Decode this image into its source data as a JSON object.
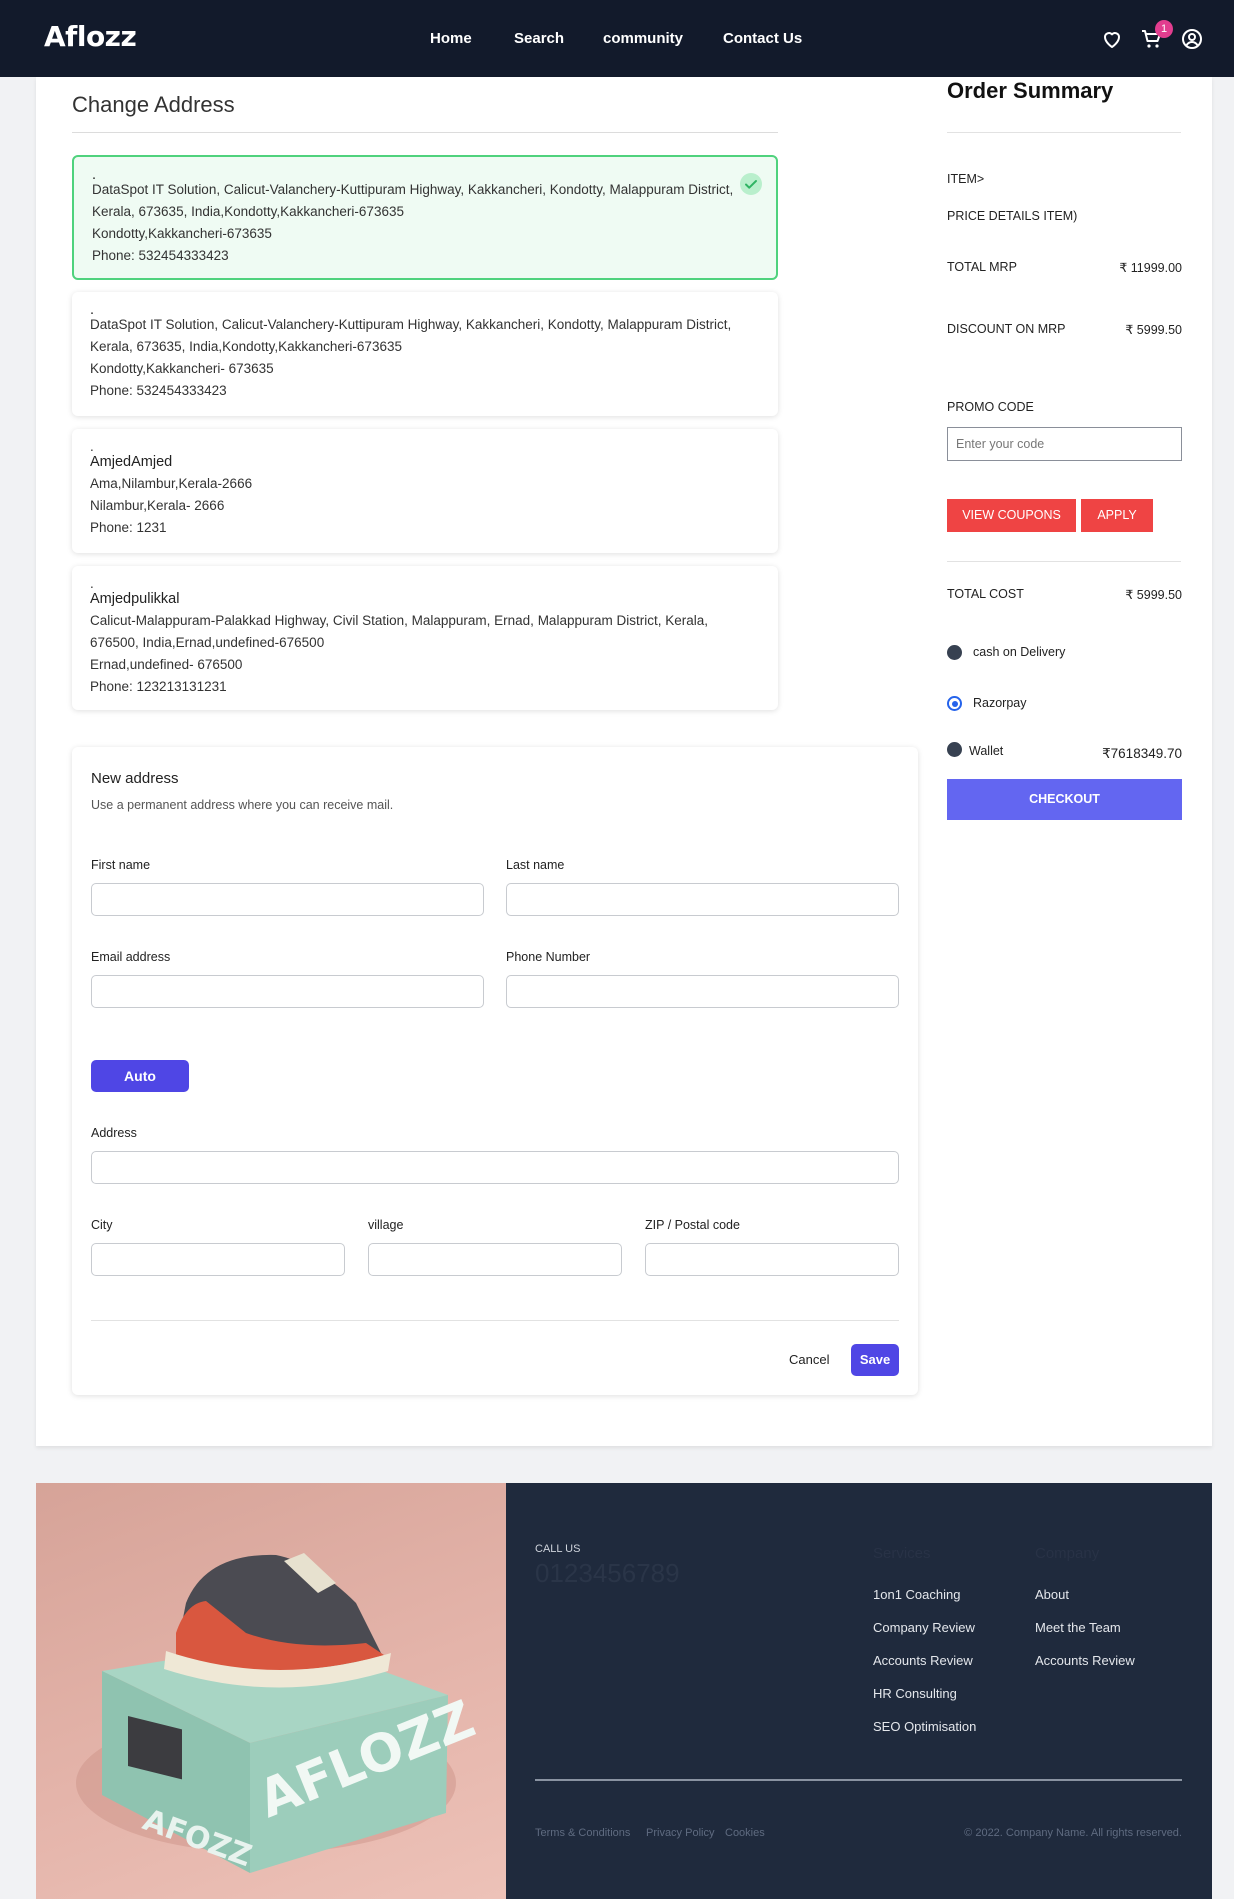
{
  "header": {
    "logo": "Aflozz",
    "nav": [
      "Home",
      "Search",
      "community",
      "Contact Us"
    ],
    "cart_count": "1",
    "icons": [
      "heart-icon",
      "cart-icon",
      "account-icon"
    ]
  },
  "change_address": {
    "title": "Change Address",
    "addresses": [
      {
        "name": ".",
        "line1": "DataSpot IT Solution, Calicut-Valanchery-Kuttipuram Highway, Kakkancheri, Kondotty, Malappuram District,",
        "line2": "Kerala, 673635, India,Kondotty,Kakkancheri-673635",
        "line3": "Kondotty,Kakkancheri-673635",
        "phone": "Phone: 532454333423",
        "selected": true
      },
      {
        "name": ".",
        "line1": "DataSpot IT Solution, Calicut-Valanchery-Kuttipuram Highway, Kakkancheri, Kondotty, Malappuram District,",
        "line2": "Kerala, 673635, India,Kondotty,Kakkancheri-673635",
        "line3": "Kondotty,Kakkancheri- 673635",
        "phone": "Phone: 532454333423",
        "selected": false
      },
      {
        "name": "AmjedAmjed",
        "line1": "Ama,Nilambur,Kerala-2666",
        "line2": "Nilambur,Kerala- 2666",
        "line3": "",
        "phone": "Phone: 1231",
        "selected": false
      },
      {
        "name": "Amjedpulikkal",
        "line1": "Calicut-Malappuram-Palakkad Highway, Civil Station, Malappuram, Ernad, Malappuram District, Kerala,",
        "line2": "676500, India,Ernad,undefined-676500",
        "line3": "Ernad,undefined- 676500",
        "phone": "Phone: 123213131231",
        "selected": false
      }
    ]
  },
  "new_address": {
    "title": "New address",
    "subtitle": "Use a permanent address where you can receive mail.",
    "first_name_label": "First name",
    "last_name_label": "Last name",
    "email_label": "Email address",
    "phone_label": "Phone Number",
    "auto_label": "Auto",
    "address_label": "Address",
    "city_label": "City",
    "village_label": "village",
    "zip_label": "ZIP / Postal code",
    "cancel_label": "Cancel",
    "save_label": "Save"
  },
  "order_summary": {
    "title": "Order Summary",
    "item_label": "ITEM>",
    "price_details_label": "PRICE DETAILS ITEM)",
    "total_mrp_label": "TOTAL MRP",
    "total_mrp_value": "₹ 11999.00",
    "discount_label": "DISCOUNT ON MRP",
    "discount_value": "₹ 5999.50",
    "promo_label": "PROMO CODE",
    "promo_placeholder": "Enter your code",
    "view_coupons_label": "VIEW COUPONS",
    "apply_label": "APPLY",
    "total_cost_label": "TOTAL COST",
    "total_cost_value": "₹ 5999.50",
    "payment_options": [
      {
        "label": "cash on Delivery",
        "checked": false
      },
      {
        "label": "Razorpay",
        "checked": true
      },
      {
        "label": "Wallet",
        "checked": false
      }
    ],
    "wallet_balance": "₹7618349.70",
    "checkout_label": "CHECKOUT"
  },
  "footer": {
    "call_label": "CALL US",
    "phone": "0123456789",
    "services_heading": "Services",
    "services": [
      "1on1 Coaching",
      "Company Review",
      "Accounts Review",
      "HR Consulting",
      "SEO Optimisation"
    ],
    "company_heading": "Company",
    "company": [
      "About",
      "Meet the Team",
      "Accounts Review"
    ],
    "legal": [
      "Terms & Conditions",
      "Privacy Policy",
      "Cookies"
    ],
    "copyright": "© 2022. Company Name. All rights reserved.",
    "box_brand": "AFLOZZ",
    "box_brand_small": "AFOZZ"
  },
  "colors": {
    "header_bg": "#121a2b",
    "primary": "#4f46e5",
    "checkout": "#6366f1",
    "danger": "#ef4444",
    "selected_border": "#4fd27d",
    "footer_bg": "#1f2a3d"
  }
}
